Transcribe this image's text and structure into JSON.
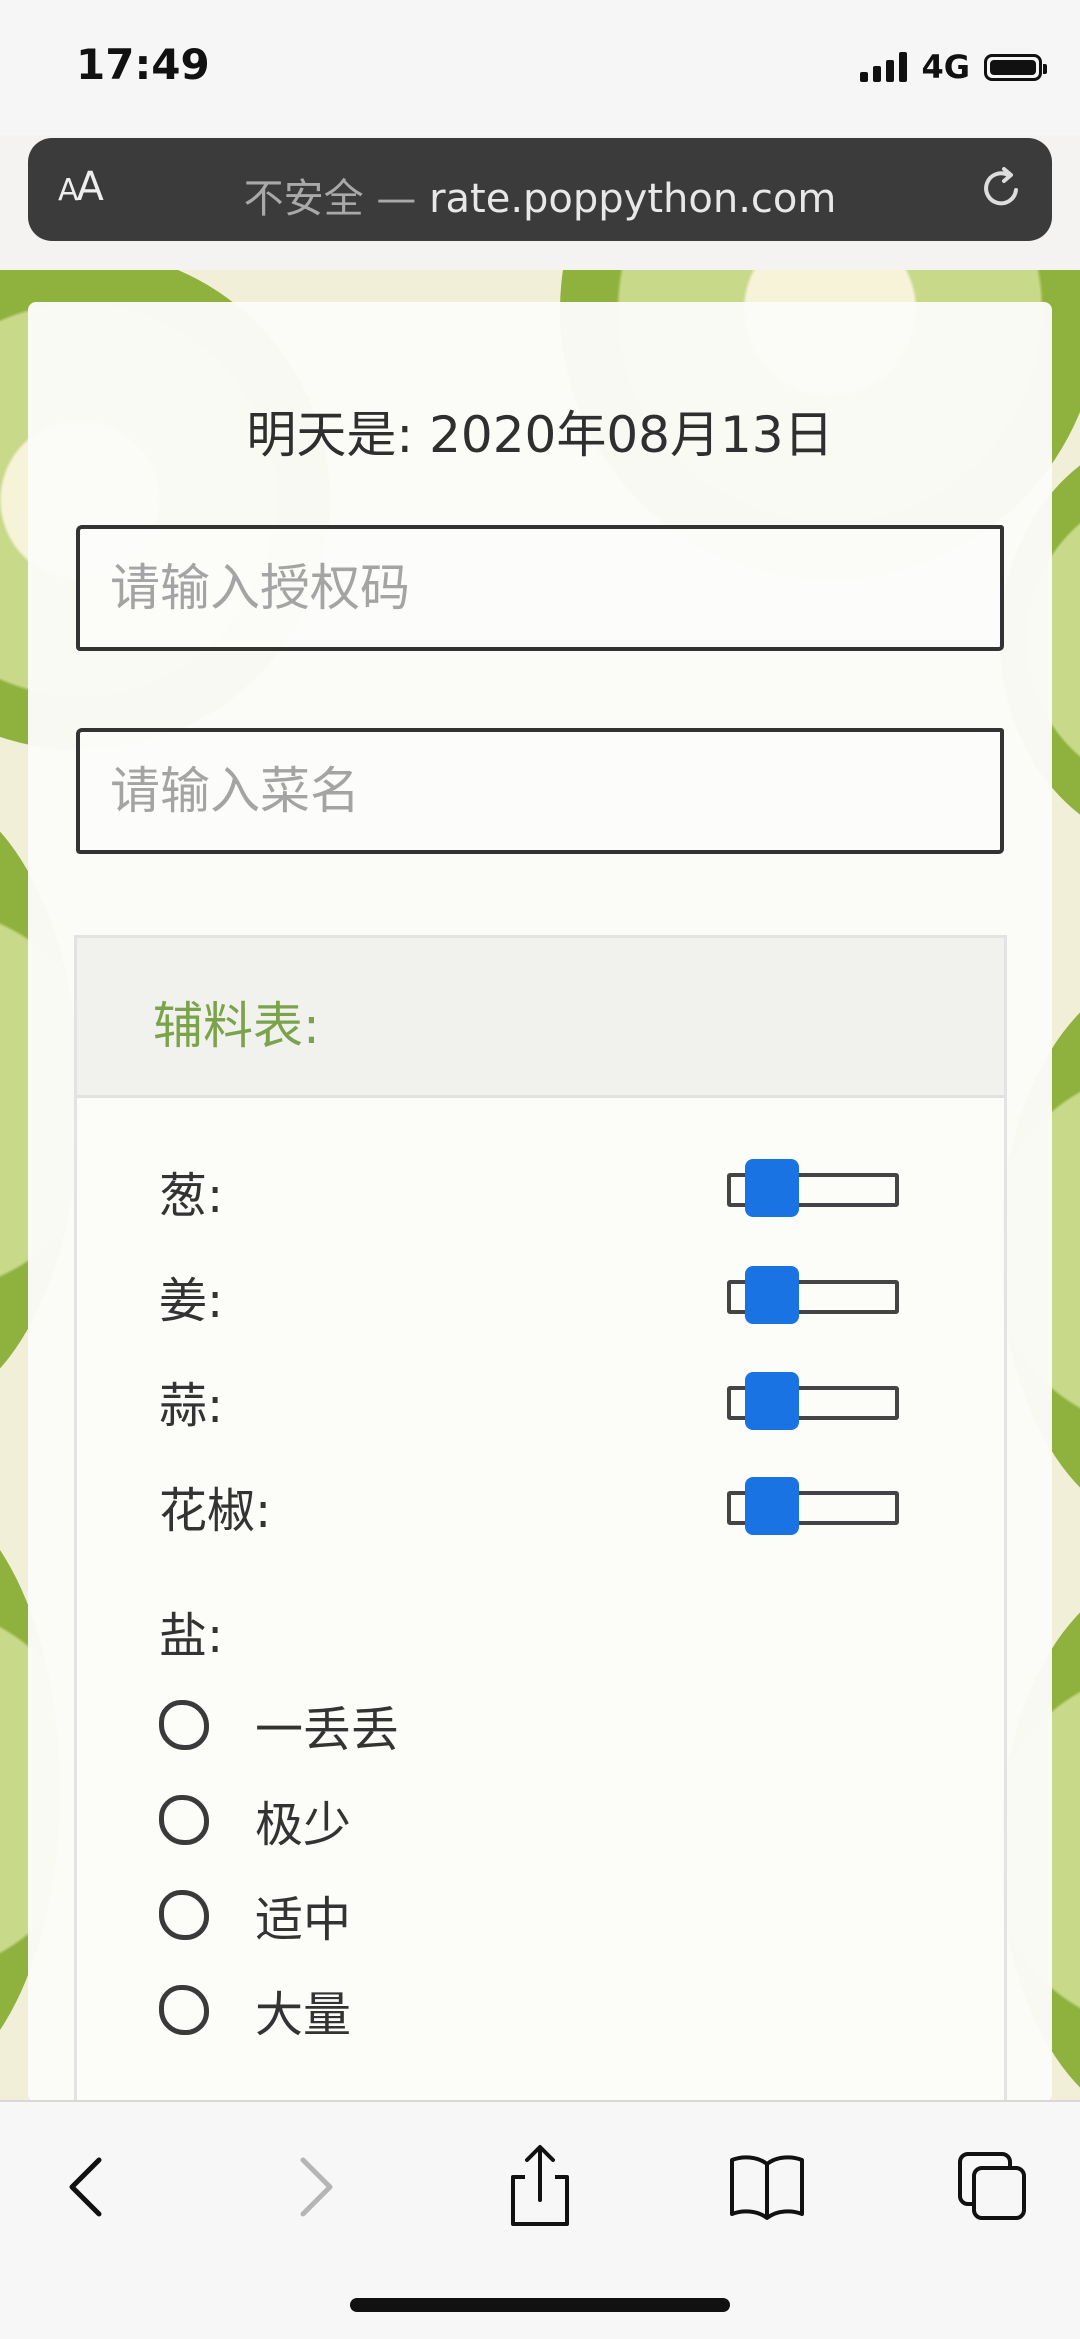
{
  "status_bar": {
    "time": "17:49",
    "network": "4G",
    "icons": [
      "signal-icon",
      "battery-icon"
    ]
  },
  "browser": {
    "aa_label": "AA",
    "insecure_label": "不安全",
    "separator": " — ",
    "domain": "rate.poppython.com",
    "reload_icon": "reload-icon"
  },
  "form": {
    "date_label": "明天是: 2020年08月13日",
    "auth_code_placeholder": "请输入授权码",
    "dish_name_placeholder": "请输入菜名",
    "ingredients_title": "辅料表:",
    "sliders": [
      {
        "label": "葱:",
        "value": 0
      },
      {
        "label": "姜:",
        "value": 0
      },
      {
        "label": "蒜:",
        "value": 0
      },
      {
        "label": "花椒:",
        "value": 0
      }
    ],
    "salt_label": "盐:",
    "salt_options": [
      "一丢丢",
      "极少",
      "适中",
      "大量"
    ]
  },
  "toolbar": {
    "icons": [
      "back-icon",
      "forward-icon",
      "share-icon",
      "bookmarks-icon",
      "tabs-icon"
    ]
  },
  "colors": {
    "accent_green": "#7ba34b",
    "slider_blue": "#1a73e2",
    "url_bar_bg": "#3b3b3b"
  }
}
